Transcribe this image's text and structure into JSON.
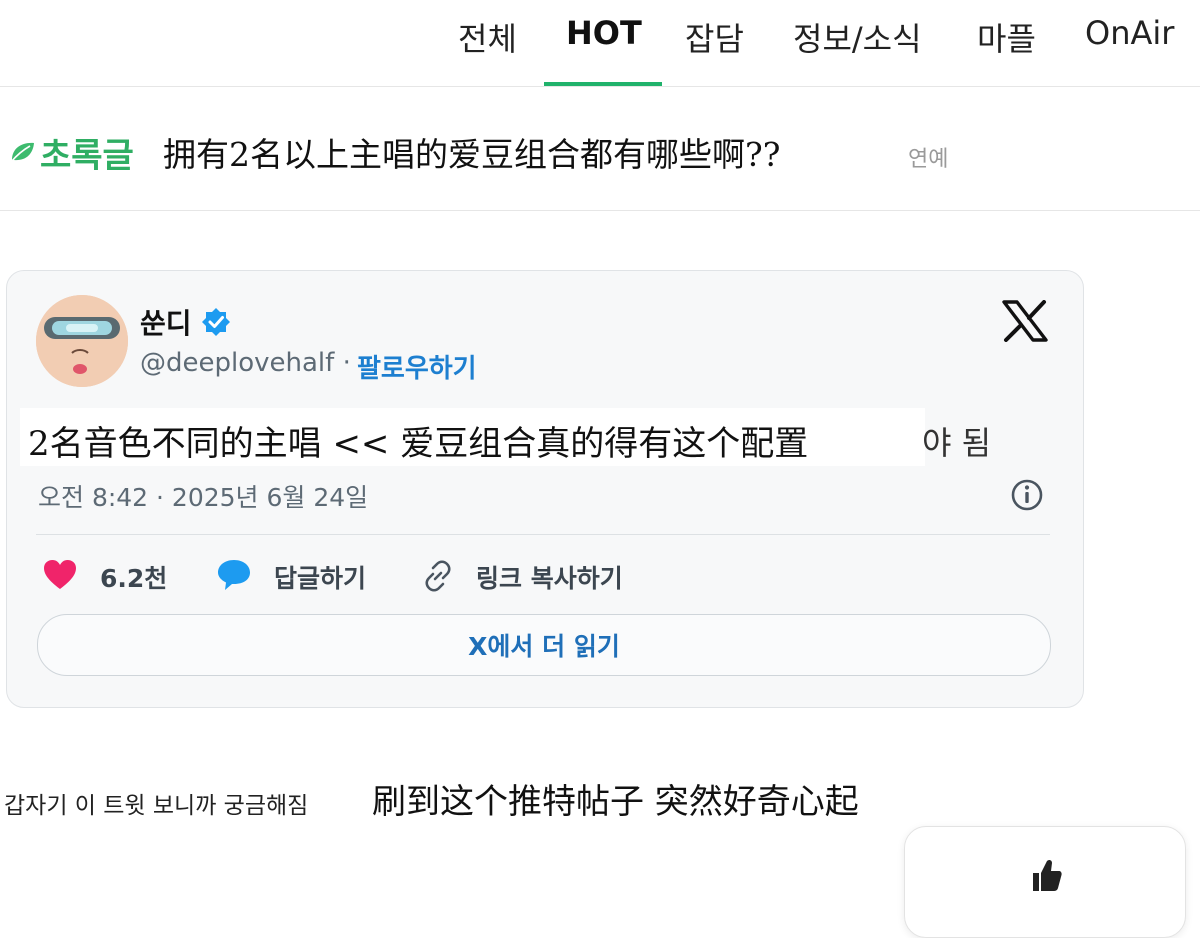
{
  "nav": {
    "tabs": [
      "전체",
      "HOT",
      "잡담",
      "정보/소식",
      "마플",
      "OnAir"
    ],
    "active_index": 1,
    "accent_color": "#20b26b"
  },
  "post": {
    "category": "초록글",
    "category_icon": "leaf-icon",
    "title": "拥有2名以上主唱的爱豆组合都有哪些啊??",
    "tag": "연예"
  },
  "tweet": {
    "display_name": "쑨디",
    "verified": true,
    "handle": "@deeplovehalf",
    "separator": " · ",
    "follow_label": "팔로우하기",
    "text": "2名音色不同的主唱 << 爱豆组合真的得有这个配置",
    "text_tail": "야 됨",
    "timestamp": "오전 8:42 · 2025년 6월 24일",
    "actions": {
      "like_count": "6.2천",
      "reply_label": "답글하기",
      "copy_link_label": "링크 복사하기"
    },
    "read_more_label": "X에서 더 읽기",
    "colors": {
      "link": "#1d7fd0",
      "like": "#f0246a",
      "reply": "#1d9bf0"
    }
  },
  "caption": {
    "korean": "갑자기 이 트윗 보니까 궁금해짐",
    "chinese": "刷到这个推特帖子 突然好奇心起"
  }
}
